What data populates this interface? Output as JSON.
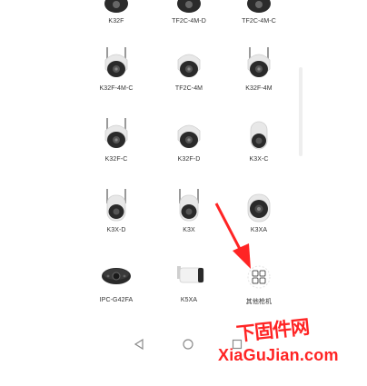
{
  "devices": [
    {
      "label": "K32F",
      "type": "dome-antenna"
    },
    {
      "label": "TF2C-4M-D",
      "type": "dome"
    },
    {
      "label": "TF2C-4M-C",
      "type": "dome"
    },
    {
      "label": "K32F-4M-C",
      "type": "dome-antenna"
    },
    {
      "label": "TF2C-4M",
      "type": "dome"
    },
    {
      "label": "K32F-4M",
      "type": "dome-antenna"
    },
    {
      "label": "K32F-C",
      "type": "dome-antenna"
    },
    {
      "label": "K32F-D",
      "type": "dome"
    },
    {
      "label": "K3X-C",
      "type": "pod"
    },
    {
      "label": "K3X-D",
      "type": "pod-antenna"
    },
    {
      "label": "K3X",
      "type": "pod-antenna"
    },
    {
      "label": "K3XA",
      "type": "bullet-round"
    },
    {
      "label": "IPC-G42FA",
      "type": "oval"
    },
    {
      "label": "K5XA",
      "type": "bullet"
    },
    {
      "label": "其他枪机",
      "type": "grid"
    }
  ],
  "watermark": {
    "cn": "下固件网",
    "en": "XiaGuJian.com"
  },
  "colors": {
    "accent": "#ff2424",
    "label": "#333333",
    "nav": "#8a8a8a"
  },
  "nav": {
    "back_icon": "back-triangle-icon",
    "home_icon": "home-circle-icon",
    "recents_icon": "recents-square-icon"
  }
}
